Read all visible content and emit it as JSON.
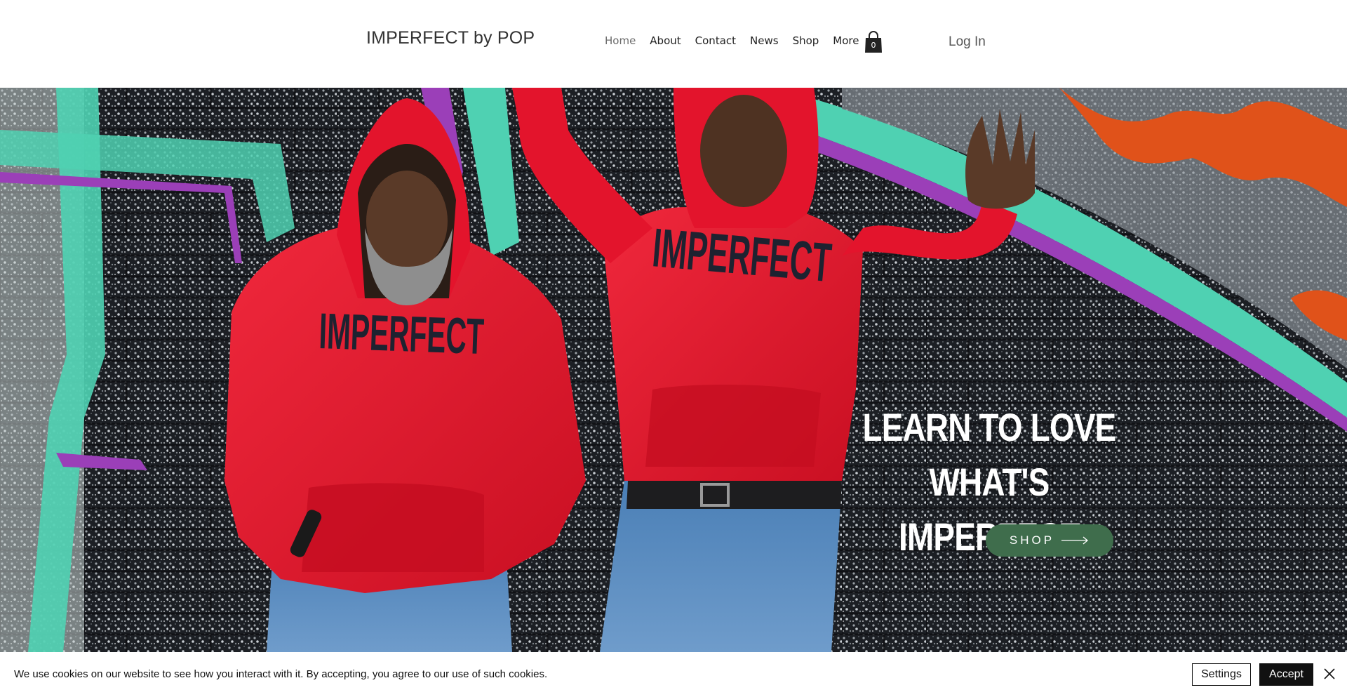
{
  "header": {
    "logo": "IMPERFECT by POP",
    "nav": [
      "Home",
      "About",
      "Contact",
      "News",
      "Shop",
      "More"
    ],
    "active_nav": "Home",
    "cart_count": "0",
    "login": "Log In"
  },
  "hero": {
    "headline_line1": "LEARN TO LOVE WHAT'S",
    "headline_line2": "IMPERFECT",
    "shop_button": "SHOP",
    "shirt_print": "IMPERFECT",
    "colors": {
      "hoodie": "#e3142c",
      "button": "#3f6d4c",
      "wall_teal": "#4fd1b2",
      "wall_purple": "#9b3fb8",
      "wall_orange": "#e0521a"
    }
  },
  "cookie": {
    "message": "We use cookies on our website to see how you interact with it. By accepting, you agree to our use of such cookies.",
    "settings": "Settings",
    "accept": "Accept"
  }
}
